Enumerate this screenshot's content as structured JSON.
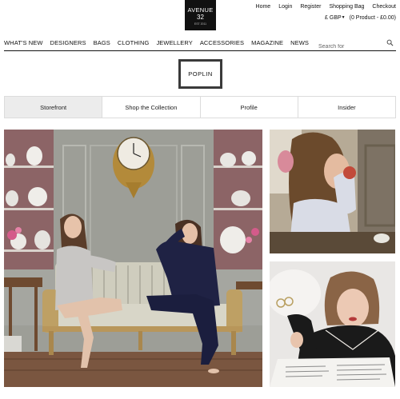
{
  "logo": {
    "line1": "AVENUE",
    "line2": "32",
    "line3": "EST 2011"
  },
  "utility_nav": [
    "Home",
    "Login",
    "Register",
    "Shopping Bag",
    "Checkout"
  ],
  "cart": {
    "currency": "£ GBP",
    "summary": "(0 Product - £0.00)"
  },
  "main_nav": [
    "WHAT'S NEW",
    "DESIGNERS",
    "BAGS",
    "CLOTHING",
    "JEWELLERY",
    "ACCESSORIES",
    "MAGAZINE",
    "NEWS"
  ],
  "search": {
    "placeholder": "Search for"
  },
  "brand": {
    "name": "POPLIN"
  },
  "tabs": [
    {
      "label": "Storefront",
      "active": true
    },
    {
      "label": "Shop the Collection",
      "active": false
    },
    {
      "label": "Profile",
      "active": false
    },
    {
      "label": "Insider",
      "active": false
    }
  ],
  "icons": {
    "search": "search-icon",
    "currency_dropdown": "triangle-down-icon"
  }
}
